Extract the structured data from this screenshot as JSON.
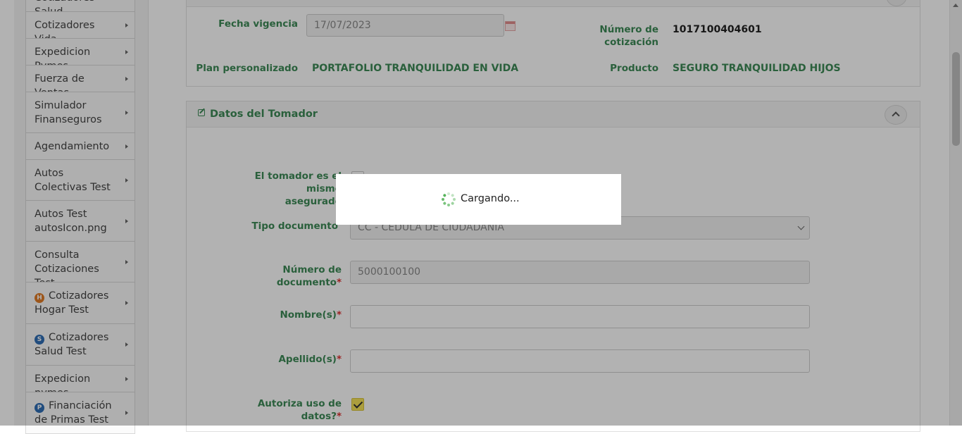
{
  "sidebar": {
    "items": [
      {
        "label": "Cotizadores Salud",
        "icon": null
      },
      {
        "label": "Cotizadores Vida",
        "icon": null
      },
      {
        "label": "Expedicion Pymes",
        "icon": null
      },
      {
        "label": "Fuerza de Ventas",
        "icon": null
      },
      {
        "label": "Simulador Finanseguros",
        "icon": null
      },
      {
        "label": "Agendamiento",
        "icon": null
      },
      {
        "label": "Autos Colectivas Test",
        "icon": null
      },
      {
        "label": "Autos Test autosIcon.png",
        "icon": null
      },
      {
        "label": "Consulta Cotizaciones Test",
        "icon": null
      },
      {
        "label": "Cotizadores Hogar Test",
        "icon": "home-icon",
        "icon_letter": "H",
        "icon_color": "#e07b28"
      },
      {
        "label": "Cotizadores Salud Test",
        "icon": "health-icon",
        "icon_letter": "S",
        "icon_color": "#2f6db5"
      },
      {
        "label": "Expedicion pymes",
        "icon": null
      },
      {
        "label": "Financiación de Primas Test",
        "icon": "financing-icon",
        "icon_letter": "P",
        "icon_color": "#2f6db5"
      }
    ]
  },
  "quote": {
    "fecha_vigencia_label": "Fecha vigencia",
    "fecha_vigencia_value": "17/07/2023",
    "numero_cotizacion_label": "Número de cotización",
    "numero_cotizacion_value": "1017100404601",
    "plan_label": "Plan personalizado",
    "plan_value": "PORTAFOLIO TRANQUILIDAD EN VIDA",
    "producto_label": "Producto",
    "producto_value": "SEGURO TRANQUILIDAD HIJOS"
  },
  "tomador": {
    "title": "Datos del Tomador",
    "mismo_asegurado_label": "El tomador es el mismo asegurado",
    "tipo_documento_label": "Tipo documento",
    "tipo_documento_value": "CC - CEDULA DE CIUDADANIA",
    "numero_documento_label": "Número de documento",
    "numero_documento_value": "5000100100",
    "nombres_label": "Nombre(s)",
    "nombres_value": "",
    "apellidos_label": "Apellido(s)",
    "apellidos_value": "",
    "autoriza_label": "Autoriza uso de datos?",
    "autoriza_checked": true,
    "required_mark": "*"
  },
  "loading": {
    "text": "Cargando..."
  },
  "colors": {
    "accent_green": "#3d8a57",
    "spinner_green": "#4caf50",
    "checkbox_yellow": "#f5e25a"
  }
}
